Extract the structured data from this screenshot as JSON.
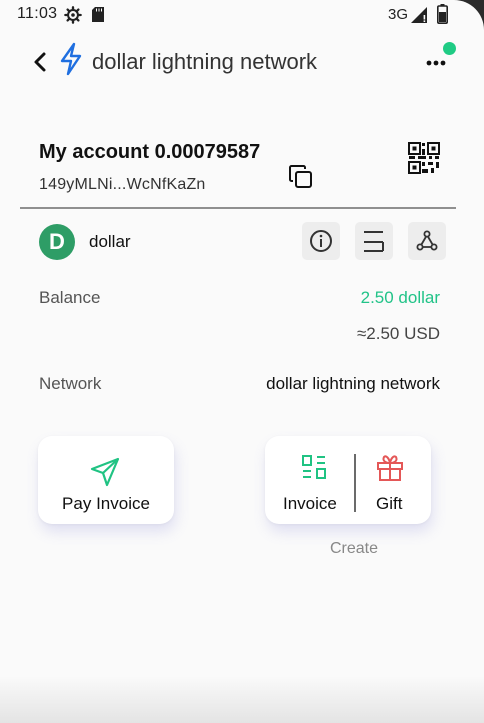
{
  "status_bar": {
    "time": "11:03",
    "network": "3G",
    "icons": [
      "gear-icon",
      "sd-card-icon",
      "signal-icon",
      "battery-icon"
    ]
  },
  "header": {
    "title": "dollar lightning network",
    "icons": [
      "back-arrow-icon",
      "lightning-bolt-icon",
      "more-dots-icon"
    ],
    "accent_color": "#1f6fe0",
    "notification_dot_color": "#1fcb84"
  },
  "account": {
    "title": "My account 0.00079587",
    "address": "149yMLNi...WcNfKaZn",
    "icons": [
      "copy-icon",
      "qr-code-icon"
    ]
  },
  "asset": {
    "avatar_letter": "D",
    "avatar_color": "#2e9d66",
    "name": "dollar",
    "tools": [
      "info-icon",
      "list-icon",
      "node-network-icon"
    ]
  },
  "details": {
    "balance_label": "Balance",
    "balance_value": "2.50 dollar",
    "balance_fiat": "≈2.50 USD",
    "balance_color": "#21c388",
    "network_label": "Network",
    "network_value": "dollar lightning network"
  },
  "actions": {
    "pay_invoice_label": "Pay Invoice",
    "invoice_label": "Invoice",
    "gift_label": "Gift",
    "create_caption": "Create",
    "pay_icon_color": "#20c383",
    "invoice_icon_color": "#20c383",
    "gift_icon_color": "#e45757"
  }
}
